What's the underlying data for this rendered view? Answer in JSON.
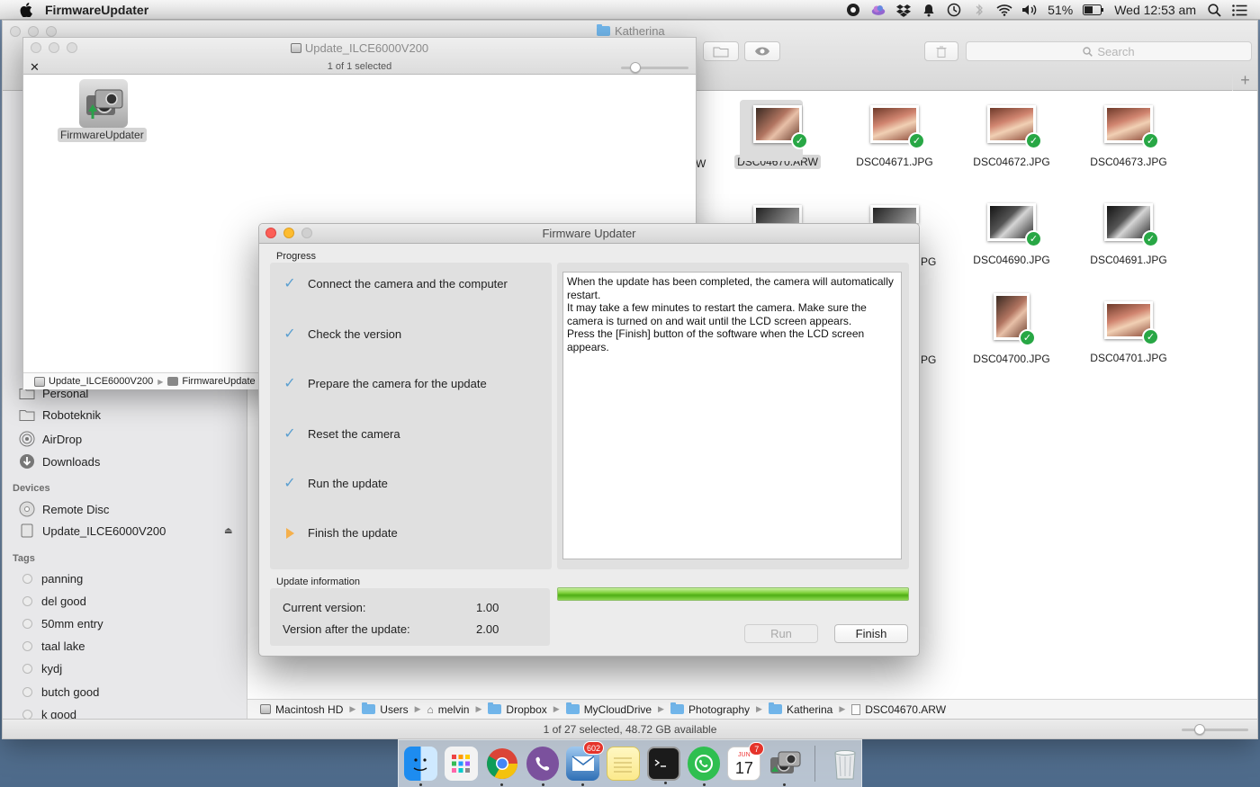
{
  "menubar": {
    "app_name": "FirmwareUpdater",
    "battery": "51%",
    "clock": "Wed 12:53 am",
    "icons": [
      "apple-icon",
      "viber-icon",
      "cloud-icon",
      "dropbox-icon",
      "notification-icon",
      "time-machine-icon",
      "bluetooth-icon",
      "wifi-icon",
      "volume-icon",
      "battery-icon",
      "spotlight-icon",
      "notification-center-icon"
    ]
  },
  "finder_main": {
    "title": "Katherina",
    "search_placeholder": "Search",
    "sidebar": {
      "favorites": [
        {
          "label": "Personal",
          "icon": "folder-icon"
        },
        {
          "label": "Roboteknik",
          "icon": "folder-icon"
        },
        {
          "label": "AirDrop",
          "icon": "airdrop-icon"
        },
        {
          "label": "Downloads",
          "icon": "downloads-icon"
        }
      ],
      "devices_header": "Devices",
      "devices": [
        {
          "label": "Remote Disc",
          "icon": "disc-icon"
        },
        {
          "label": "Update_ILCE6000V200",
          "icon": "disk-icon"
        }
      ],
      "tags_header": "Tags",
      "tags": [
        "panning",
        "del good",
        "50mm entry",
        "taal lake",
        "kydj",
        "butch good",
        "k good"
      ]
    },
    "files": [
      {
        "name": "DSC04670.ARW",
        "selected": true
      },
      {
        "name": "DSC04671.JPG"
      },
      {
        "name": "DSC04672.JPG"
      },
      {
        "name": "DSC04673.JPG"
      },
      {
        "name": "DSC04690.JPG"
      },
      {
        "name": "DSC04691.JPG"
      },
      {
        "name": "DSC04700.JPG"
      },
      {
        "name": "DSC04701.JPG"
      }
    ],
    "file_partial_labels": [
      "W",
      "PG",
      "PG"
    ],
    "path": [
      "Macintosh HD",
      "Users",
      "melvin",
      "Dropbox",
      "MyCloudDrive",
      "Photography",
      "Katherina",
      "DSC04670.ARW"
    ],
    "status": "1 of 27 selected, 48.72 GB available"
  },
  "finder_volume": {
    "title": "Update_ILCE6000V200",
    "subtitle": "1 of 1 selected",
    "app_label": "FirmwareUpdater",
    "path": [
      "Update_ILCE6000V200",
      "FirmwareUpdate"
    ]
  },
  "firmware_dialog": {
    "title": "Firmware Updater",
    "progress_label": "Progress",
    "steps": [
      {
        "label": "Connect the camera and the computer",
        "state": "done"
      },
      {
        "label": "Check the version",
        "state": "done"
      },
      {
        "label": "Prepare the camera for the update",
        "state": "done"
      },
      {
        "label": "Reset the camera",
        "state": "done"
      },
      {
        "label": "Run the update",
        "state": "done"
      },
      {
        "label": "Finish the update",
        "state": "current"
      }
    ],
    "message": [
      "When the update has been completed, the camera will automatically restart.",
      "It may take a few minutes to restart the camera. Make sure the camera is turned on and wait until the LCD screen appears.",
      "Press the [Finish] button of the software when the LCD screen appears."
    ],
    "update_info_label": "Update information",
    "current_version_label": "Current version:",
    "current_version": "1.00",
    "after_version_label": "Version after the update:",
    "after_version": "2.00",
    "progress_fraction": 1.0,
    "run_label": "Run",
    "finish_label": "Finish"
  },
  "dock": {
    "apps": [
      {
        "name": "finder-icon"
      },
      {
        "name": "launchpad-icon"
      },
      {
        "name": "chrome-icon"
      },
      {
        "name": "viber-icon"
      },
      {
        "name": "mail-icon",
        "badge": "602"
      },
      {
        "name": "notes-icon"
      },
      {
        "name": "terminal-icon"
      },
      {
        "name": "whatsapp-icon"
      },
      {
        "name": "calendar-icon",
        "badge": "7",
        "month": "JUN",
        "day": "17"
      },
      {
        "name": "firmware-updater-icon"
      },
      {
        "name": "trash-icon"
      }
    ]
  }
}
